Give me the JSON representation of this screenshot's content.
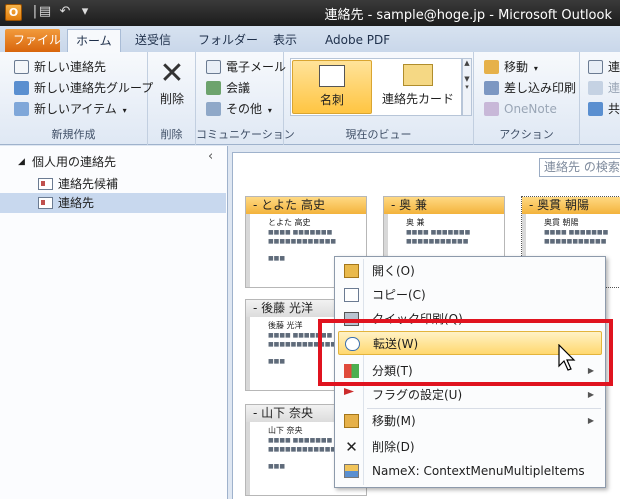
{
  "window": {
    "title": "連絡先 - sample@hoge.jp - Microsoft Outlook",
    "app_icon": "O"
  },
  "ribbon_tabs": [
    "ファイル",
    "ホーム",
    "送受信",
    "フォルダー",
    "表示",
    "Adobe PDF"
  ],
  "ribbon": {
    "new_group": {
      "label": "新規作成",
      "items": [
        "新しい連絡先",
        "新しい連絡先グループ",
        "新しいアイテム"
      ]
    },
    "delete_group": {
      "label": "削除",
      "button": "削除"
    },
    "communication_group": {
      "label": "コミュニケーション",
      "items": [
        "電子メール",
        "会議",
        "その他"
      ]
    },
    "view_group": {
      "label": "現在のビュー",
      "views": [
        "名刺",
        "連絡先カード"
      ]
    },
    "action_group": {
      "label": "アクション",
      "items": [
        "移動",
        "差し込み印刷",
        "OneNote"
      ]
    },
    "overflow_items": [
      "連",
      "連",
      "共"
    ]
  },
  "nav": {
    "header": "個人用の連絡先",
    "items": [
      "連絡先候補",
      "連絡先"
    ],
    "collapse_glyph": "‹"
  },
  "search": {
    "placeholder": "連絡先 の検索"
  },
  "cards": [
    {
      "header": "- とよた 高史",
      "name": "とよた 高史"
    },
    {
      "header": "- 奥 兼",
      "name": "奥 兼"
    },
    {
      "header": "- 奥貫 朝陽",
      "name": "奥貫 朝陽"
    },
    {
      "header": "- 後藤 光洋",
      "name": "後藤 光洋"
    },
    {
      "header": "- 山下 奈央",
      "name": "山下 奈央"
    }
  ],
  "context_menu": {
    "items": [
      {
        "label": "開く(O)",
        "icon": "open-folder-icon"
      },
      {
        "label": "コピー(C)",
        "icon": "copy-icon"
      },
      {
        "label": "クイック印刷(Q)",
        "icon": "print-icon"
      },
      {
        "label": "転送(W)",
        "icon": "forward-icon",
        "highlighted": true
      },
      {
        "label": "分類(T)",
        "icon": "categorize-icon",
        "submenu": true
      },
      {
        "label": "フラグの設定(U)",
        "icon": "flag-icon",
        "submenu": true
      },
      {
        "label": "移動(M)",
        "icon": "move-icon",
        "submenu": true
      },
      {
        "label": "削除(D)",
        "icon": "delete-x-icon"
      },
      {
        "label": "NameX: ContextMenuMultipleItems",
        "icon": "addin-icon"
      }
    ]
  },
  "colors": {
    "highlight_box": "#e0131f",
    "card_header": "#f3b33c",
    "file_tab": "#d8650c"
  }
}
